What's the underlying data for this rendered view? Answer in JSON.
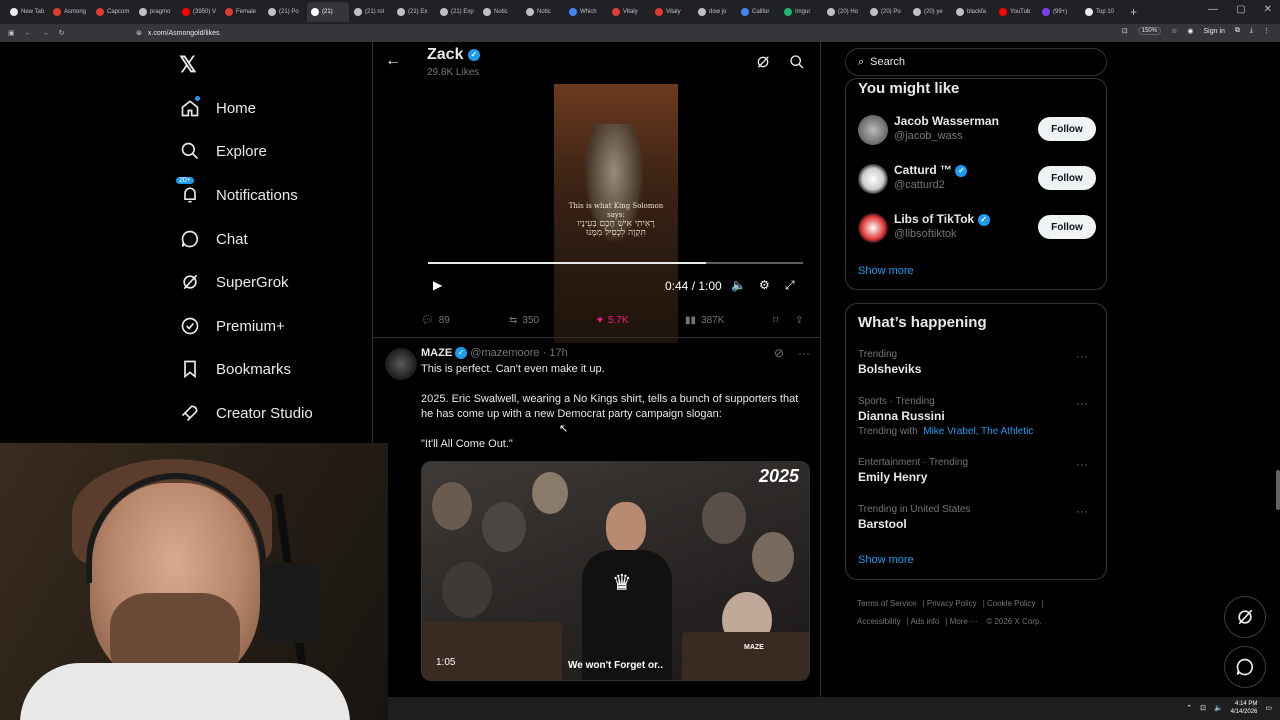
{
  "browser": {
    "tabs": [
      {
        "label": "New Tab",
        "color": "#e8eaed"
      },
      {
        "label": "Asmong",
        "color": "#e03c31"
      },
      {
        "label": "Capcom",
        "color": "#e03c31"
      },
      {
        "label": "pragmo",
        "color": "#bdc1c6"
      },
      {
        "label": "(3950) V",
        "color": "#ff0000"
      },
      {
        "label": "Female",
        "color": "#e03c31"
      },
      {
        "label": "(21) Po",
        "color": "#bdc1c6"
      },
      {
        "label": "(21)",
        "color": "#ffffff"
      },
      {
        "label": "(21) rol",
        "color": "#bdc1c6"
      },
      {
        "label": "(21) Ex",
        "color": "#bdc1c6"
      },
      {
        "label": "(21) Exp",
        "color": "#bdc1c6"
      },
      {
        "label": "Notic",
        "color": "#bdc1c6"
      },
      {
        "label": "Notic",
        "color": "#bdc1c6"
      },
      {
        "label": "Which",
        "color": "#4285f4"
      },
      {
        "label": "Vitaly",
        "color": "#e03c31"
      },
      {
        "label": "Vitaly",
        "color": "#e03c31"
      },
      {
        "label": "dow jo",
        "color": "#bdc1c6"
      },
      {
        "label": "Califor",
        "color": "#4285f4"
      },
      {
        "label": "Imgur",
        "color": "#1bb76e"
      },
      {
        "label": "(20) Ho",
        "color": "#bdc1c6"
      },
      {
        "label": "(20) Po",
        "color": "#bdc1c6"
      },
      {
        "label": "(20) ye",
        "color": "#bdc1c6"
      },
      {
        "label": "blackfa",
        "color": "#bdc1c6"
      },
      {
        "label": "YouTub",
        "color": "#ff0000"
      },
      {
        "label": "(99+)",
        "color": "#7e3ff2"
      },
      {
        "label": "Top 10",
        "color": "#e8eaed"
      }
    ],
    "url": "x.com/Asmongold/likes",
    "zoom": "150%",
    "signin": "Sign in"
  },
  "nav": {
    "items": [
      {
        "label": "Home",
        "icon": "home-icon"
      },
      {
        "label": "Explore",
        "icon": "search-icon"
      },
      {
        "label": "Notifications",
        "icon": "bell-icon",
        "badge": "20+"
      },
      {
        "label": "Chat",
        "icon": "chat-icon"
      },
      {
        "label": "SuperGrok",
        "icon": "grok-icon"
      },
      {
        "label": "Premium+",
        "icon": "premium-icon"
      },
      {
        "label": "Bookmarks",
        "icon": "bookmark-icon"
      },
      {
        "label": "Creator Studio",
        "icon": "rocket-icon"
      }
    ]
  },
  "header": {
    "title": "Zack",
    "subtitle": "29.8K Likes"
  },
  "video1": {
    "caption_line1": "This is what King Solomon says:",
    "caption_line2": "רָאִיתִי אִישׁ חָכָם בְּעֵינָיו",
    "caption_line3": "תִּקְוָה לִכְסִיל מִמֶּנּוּ",
    "time": "0:44 / 1:00",
    "progress": 0.74
  },
  "tweet1_actions": {
    "replies": "89",
    "reposts": "350",
    "likes": "5.7K",
    "views": "387K"
  },
  "tweet2": {
    "name": "MAZE",
    "handle": "@mazemoore",
    "time": "17h",
    "line1": "This is perfect. Can't even make it up.",
    "line2": "2025. Eric Swalwell, wearing a No Kings shirt, tells a bunch of supporters that he has come up with a new Democrat party campaign slogan:",
    "line3": "\"It'll All Come Out.\"",
    "media_year": "2025",
    "media_duration": "1:05",
    "media_subtitle": "We won't Forget or..",
    "media_watermark": "MAZE"
  },
  "right": {
    "search_placeholder": "Search",
    "you_might_like_title": "You might like",
    "suggestions": [
      {
        "name": "Jacob Wasserman",
        "handle": "@jacob_wass",
        "verified": false,
        "button": "Follow"
      },
      {
        "name": "Catturd ™",
        "handle": "@catturd2",
        "verified": true,
        "button": "Follow"
      },
      {
        "name": "Libs of TikTok",
        "handle": "@libsoftiktok",
        "verified": true,
        "button": "Follow"
      }
    ],
    "show_more": "Show more",
    "happening_title": "What’s happening",
    "trends": [
      {
        "category": "Trending",
        "name": "Bolsheviks",
        "with_label": "",
        "with_links": ""
      },
      {
        "category": "Sports · Trending",
        "name": "Dianna Russini",
        "with_label": "Trending with",
        "with_links": "Mike Vrabel, The Athletic"
      },
      {
        "category": "Entertainment · Trending",
        "name": "Emily Henry",
        "with_label": "",
        "with_links": ""
      },
      {
        "category": "Trending in United States",
        "name": "Barstool",
        "with_label": "",
        "with_links": ""
      }
    ],
    "show_more_2": "Show more",
    "footer": {
      "terms": "Terms of Service",
      "privacy": "Privacy Policy",
      "cookie": "Cookie Policy",
      "accessibility": "Accessibility",
      "ads": "Ads info",
      "more": "More ···",
      "copyright": "© 2026 X Corp."
    }
  },
  "taskbar": {
    "time": "4:14 PM",
    "date": "4/14/2026"
  }
}
